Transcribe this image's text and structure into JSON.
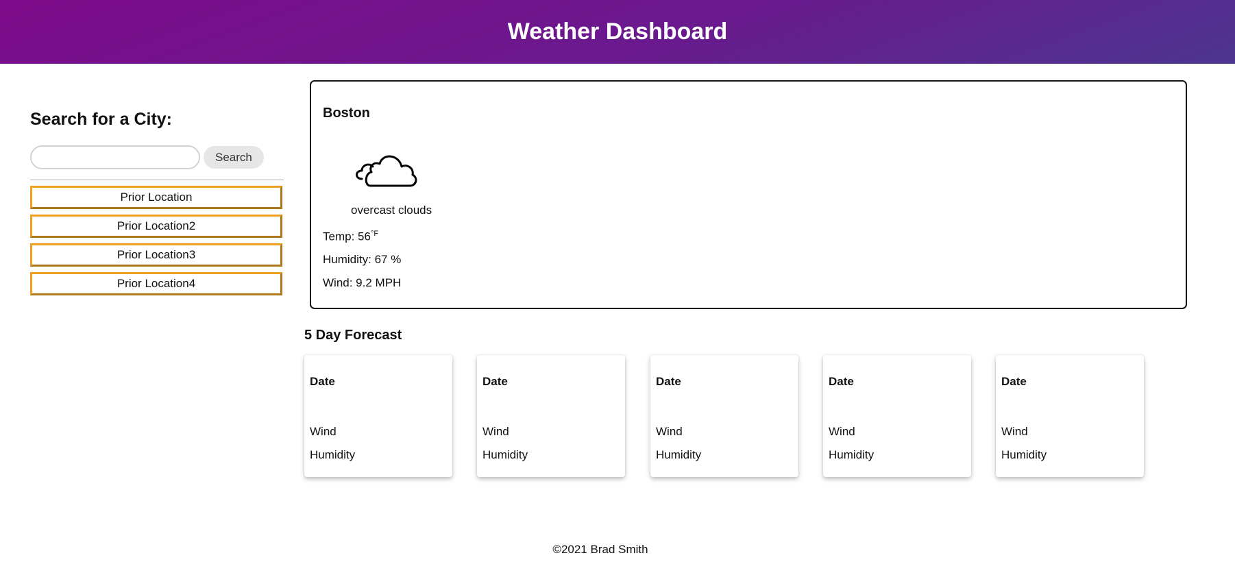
{
  "header": {
    "title": "Weather Dashboard"
  },
  "sidebar": {
    "heading": "Search for a City:",
    "search": {
      "value": "",
      "placeholder": "",
      "button_label": "Search"
    },
    "prior_locations": [
      "Prior Location",
      "Prior Location2",
      "Prior Location3",
      "Prior Location4"
    ]
  },
  "current": {
    "city": "Boston",
    "icon": "cloud-icon",
    "description": "overcast clouds",
    "temp_label": "Temp: 56",
    "temp_unit": "°F",
    "humidity": "Humidity: 67 %",
    "wind": "Wind: 9.2 MPH"
  },
  "forecast": {
    "title": "5 Day Forecast",
    "days": [
      {
        "date": "Date",
        "wind": "Wind",
        "humidity": "Humidity"
      },
      {
        "date": "Date",
        "wind": "Wind",
        "humidity": "Humidity"
      },
      {
        "date": "Date",
        "wind": "Wind",
        "humidity": "Humidity"
      },
      {
        "date": "Date",
        "wind": "Wind",
        "humidity": "Humidity"
      },
      {
        "date": "Date",
        "wind": "Wind",
        "humidity": "Humidity"
      }
    ]
  },
  "footer": {
    "text": "©2021 Brad Smith"
  },
  "colors": {
    "header_gradient_start": "#7d0a8a",
    "header_gradient_end": "#4c3590",
    "prior_button_border": "#f0a020"
  }
}
